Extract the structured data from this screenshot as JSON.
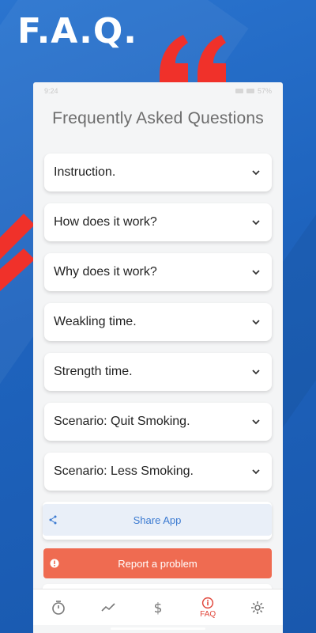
{
  "promo": {
    "title": "F.A.Q."
  },
  "status_bar": {
    "time": "9:24",
    "battery": "57%"
  },
  "page": {
    "title": "Frequently Asked Questions"
  },
  "faq": [
    {
      "label": "Instruction."
    },
    {
      "label": "How does it work?"
    },
    {
      "label": "Why does it work?"
    },
    {
      "label": "Weakling time."
    },
    {
      "label": "Strength time."
    },
    {
      "label": "Scenario: Quit Smoking."
    },
    {
      "label": "Scenario: Less Smoking."
    }
  ],
  "actions": {
    "share_label": "Share App",
    "report_label": "Report a problem"
  },
  "bottom_nav": {
    "items": [
      {
        "icon": "timer-icon",
        "label": ""
      },
      {
        "icon": "chart-trend-icon",
        "label": ""
      },
      {
        "icon": "dollar-icon",
        "label": ""
      },
      {
        "icon": "info-icon",
        "label": "FAQ",
        "active": true
      },
      {
        "icon": "gear-icon",
        "label": ""
      }
    ]
  },
  "colors": {
    "background": "#1f68c2",
    "accent_red": "#f0312a",
    "report_button": "#ef6b51",
    "share_text": "#3b7ad1",
    "active_nav": "#e0463a"
  }
}
